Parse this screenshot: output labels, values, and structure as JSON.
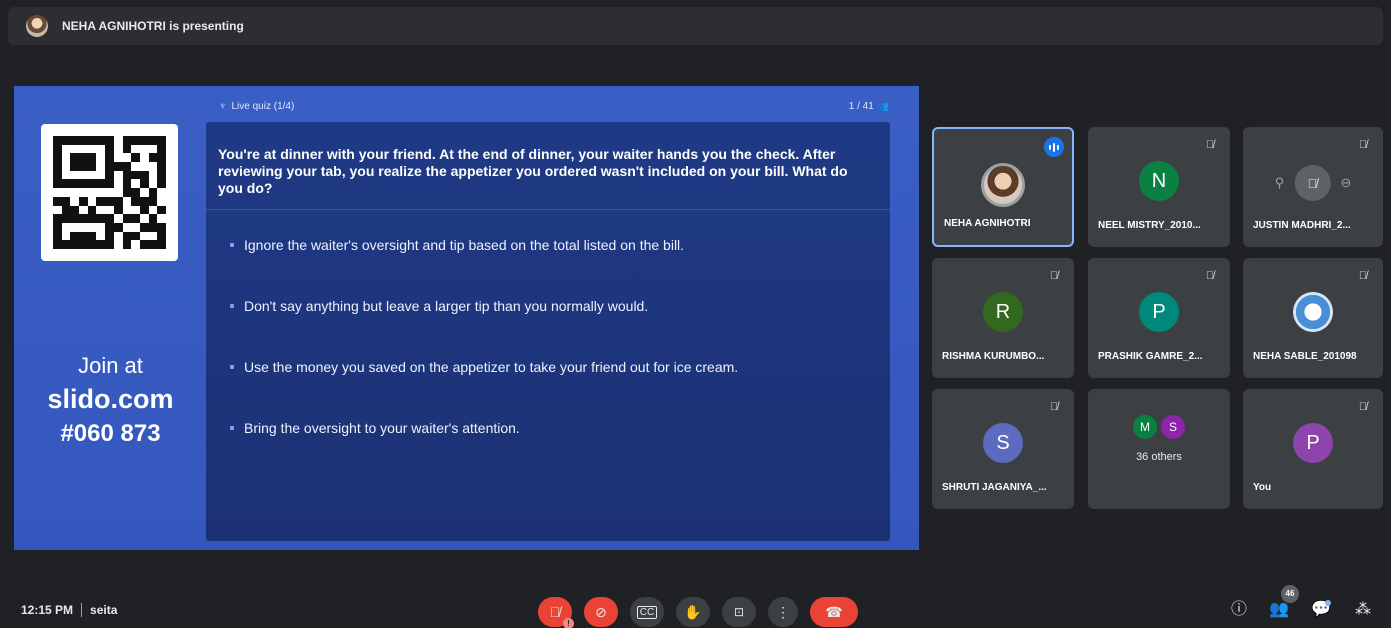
{
  "presenting": {
    "text": "NEHA AGNIHOTRI is presenting"
  },
  "slide": {
    "header_left": "Live quiz (1/4)",
    "header_right": "1 / 41",
    "join_at": "Join at",
    "join_domain": "slido.com",
    "join_code": "#060 873",
    "question": "You're at dinner with your friend. At the end of dinner, your waiter hands you the check. After reviewing your tab, you realize the appetizer you ordered wasn't included on your bill. What do you do?",
    "options": [
      "Ignore the waiter's oversight and tip based on the total listed on the bill.",
      "Don't say anything but leave a larger tip than you normally would.",
      "Use the money you saved on the appetizer to take your friend out for ice cream.",
      "Bring the oversight to your waiter's attention."
    ]
  },
  "participants": [
    {
      "name": "NEHA AGNIHOTRI",
      "initial": "",
      "color": "#9aa0a6",
      "speaking": true
    },
    {
      "name": "NEEL MISTRY_2010...",
      "initial": "N",
      "color": "#0b8043",
      "muted": true
    },
    {
      "name": "JUSTIN MADHRI_2...",
      "initial": "",
      "color": "#5f6368",
      "muted": true
    },
    {
      "name": "RISHMA KURUMBO...",
      "initial": "R",
      "color": "#33691e",
      "muted": true
    },
    {
      "name": "PRASHIK GAMRE_2...",
      "initial": "P",
      "color": "#00897b",
      "muted": true
    },
    {
      "name": "NEHA SABLE_201098",
      "initial": "",
      "color": "#4a8fd6",
      "muted": true
    },
    {
      "name": "SHRUTI JAGANIYA_...",
      "initial": "S",
      "color": "#5c6bc0",
      "muted": true
    },
    {
      "name": "36 others",
      "initials": [
        "M",
        "S"
      ],
      "colors": [
        "#0b8043",
        "#8e24aa"
      ]
    },
    {
      "name": "You",
      "initial": "P",
      "color": "#8e44ad",
      "muted": true
    }
  ],
  "bottom": {
    "time": "12:15 PM",
    "meeting": "seita",
    "participant_count": "46"
  },
  "colors": {
    "end_call": "#ea4335",
    "active_border": "#8ab4f8"
  }
}
